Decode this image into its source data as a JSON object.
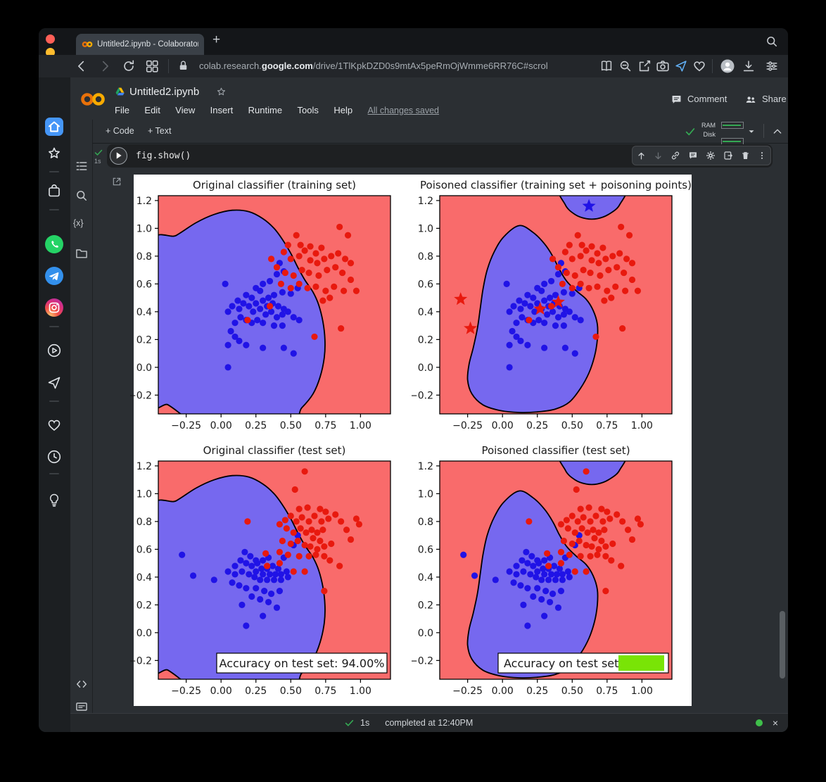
{
  "browser": {
    "tab_title": "Untitled2.ipynb - Colaboratory",
    "new_tab": "+",
    "url_prefix": "colab.research.",
    "url_host": "google.com",
    "url_path": "/drive/1TlKpkDZD0s9mtAx5peRmOjWmme6RR76C#scrol"
  },
  "colab": {
    "doc_title": "Untitled2.ipynb",
    "menus": [
      "File",
      "Edit",
      "View",
      "Insert",
      "Runtime",
      "Tools",
      "Help"
    ],
    "save_status": "All changes saved",
    "comment_label": "Comment",
    "share_label": "Share",
    "add_code": "+ Code",
    "add_text": "+ Text",
    "ram_label": "RAM",
    "disk_label": "Disk",
    "vars_label": "{x}",
    "cell": {
      "code": "fig.show()",
      "exec_badge": "1s"
    },
    "status_bar": {
      "duration": "1s",
      "message": "completed at 12:40PM",
      "close": "×"
    }
  },
  "chart_data": {
    "type": "scatter",
    "colors": {
      "region_red": "#f96b6b",
      "region_blue": "#7668ef",
      "point_red": "#e8190e",
      "point_blue": "#2013e6",
      "boundary": "#000000",
      "accuracy_green": "#79e406",
      "text": "#1a1a1a"
    },
    "axes": {
      "xlim": [
        -0.45,
        1.215
      ],
      "ylim": [
        -0.335,
        1.235
      ],
      "xticks": [
        -0.25,
        0,
        0.25,
        0.5,
        0.75,
        1.0
      ],
      "yticks": [
        -0.2,
        0,
        0.2,
        0.4,
        0.6,
        0.8,
        1.0,
        1.2
      ]
    },
    "regions": {
      "original": [
        [
          -0.52,
          0.84
        ],
        [
          -0.32,
          0.95
        ],
        [
          -0.18,
          1.04
        ],
        [
          -0.05,
          1.1
        ],
        [
          0.08,
          1.13
        ],
        [
          0.2,
          1.12
        ],
        [
          0.3,
          1.07
        ],
        [
          0.38,
          1.0
        ],
        [
          0.44,
          0.92
        ],
        [
          0.5,
          0.82
        ],
        [
          0.55,
          0.72
        ],
        [
          0.6,
          0.63
        ],
        [
          0.66,
          0.54
        ],
        [
          0.7,
          0.45
        ],
        [
          0.73,
          0.33
        ],
        [
          0.745,
          0.2
        ],
        [
          0.74,
          0.07
        ],
        [
          0.71,
          -0.07
        ],
        [
          0.66,
          -0.19
        ],
        [
          0.58,
          -0.29
        ],
        [
          0.46,
          -0.4
        ],
        [
          -0.2,
          -0.4
        ],
        [
          -0.27,
          -0.35
        ],
        [
          -0.38,
          -0.27
        ],
        [
          -0.52,
          -0.2
        ]
      ],
      "poisoned_main": [
        [
          0.12,
          1.02
        ],
        [
          0.22,
          0.97
        ],
        [
          0.3,
          0.89
        ],
        [
          0.36,
          0.8
        ],
        [
          0.41,
          0.7
        ],
        [
          0.46,
          0.62
        ],
        [
          0.53,
          0.55
        ],
        [
          0.6,
          0.49
        ],
        [
          0.65,
          0.41
        ],
        [
          0.68,
          0.31
        ],
        [
          0.68,
          0.2
        ],
        [
          0.66,
          0.08
        ],
        [
          0.62,
          -0.04
        ],
        [
          0.56,
          -0.15
        ],
        [
          0.48,
          -0.25
        ],
        [
          0.38,
          -0.3
        ],
        [
          0.26,
          -0.32
        ],
        [
          0.12,
          -0.325
        ],
        [
          -0.02,
          -0.31
        ],
        [
          -0.14,
          -0.27
        ],
        [
          -0.22,
          -0.19
        ],
        [
          -0.25,
          -0.09
        ],
        [
          -0.24,
          0.02
        ],
        [
          -0.21,
          0.14
        ],
        [
          -0.18,
          0.28
        ],
        [
          -0.16,
          0.42
        ],
        [
          -0.14,
          0.56
        ],
        [
          -0.11,
          0.7
        ],
        [
          -0.06,
          0.83
        ],
        [
          0.01,
          0.94
        ]
      ],
      "poisoned_top": [
        [
          0.43,
          1.3
        ],
        [
          0.45,
          1.17
        ],
        [
          0.52,
          1.1
        ],
        [
          0.6,
          1.07
        ],
        [
          0.68,
          1.07
        ],
        [
          0.76,
          1.1
        ],
        [
          0.84,
          1.17
        ],
        [
          0.86,
          1.3
        ]
      ]
    },
    "point_sets": {
      "train_blue": [
        [
          0.03,
          0.6
        ],
        [
          0.42,
          0.75
        ],
        [
          0.45,
          0.69
        ],
        [
          0.4,
          0.67
        ],
        [
          0.3,
          0.6
        ],
        [
          0.35,
          0.62
        ],
        [
          0.25,
          0.57
        ],
        [
          0.28,
          0.55
        ],
        [
          0.18,
          0.52
        ],
        [
          0.22,
          0.5
        ],
        [
          0.12,
          0.48
        ],
        [
          0.16,
          0.46
        ],
        [
          0.08,
          0.44
        ],
        [
          0.13,
          0.42
        ],
        [
          0.05,
          0.4
        ],
        [
          0.2,
          0.44
        ],
        [
          0.25,
          0.46
        ],
        [
          0.3,
          0.48
        ],
        [
          0.34,
          0.5
        ],
        [
          0.38,
          0.52
        ],
        [
          0.44,
          0.54
        ],
        [
          0.5,
          0.53
        ],
        [
          0.55,
          0.57
        ],
        [
          0.33,
          0.44
        ],
        [
          0.37,
          0.46
        ],
        [
          0.41,
          0.44
        ],
        [
          0.45,
          0.42
        ],
        [
          0.28,
          0.42
        ],
        [
          0.23,
          0.4
        ],
        [
          0.32,
          0.38
        ],
        [
          0.36,
          0.4
        ],
        [
          0.4,
          0.36
        ],
        [
          0.44,
          0.38
        ],
        [
          0.48,
          0.4
        ],
        [
          0.52,
          0.36
        ],
        [
          0.56,
          0.34
        ],
        [
          0.14,
          0.36
        ],
        [
          0.18,
          0.34
        ],
        [
          0.1,
          0.32
        ],
        [
          0.22,
          0.32
        ],
        [
          0.26,
          0.34
        ],
        [
          0.3,
          0.32
        ],
        [
          0.38,
          0.3
        ],
        [
          0.44,
          0.3
        ],
        [
          0.07,
          0.26
        ],
        [
          0.1,
          0.22
        ],
        [
          0.13,
          0.19
        ],
        [
          0.05,
          0.16
        ],
        [
          0.18,
          0.16
        ],
        [
          0.3,
          0.14
        ],
        [
          0.45,
          0.14
        ],
        [
          0.52,
          0.1
        ],
        [
          0.05,
          0.0
        ]
      ],
      "train_red": [
        [
          0.85,
          1.01
        ],
        [
          0.91,
          0.95
        ],
        [
          0.48,
          0.88
        ],
        [
          0.54,
          0.95
        ],
        [
          0.57,
          0.88
        ],
        [
          0.45,
          0.83
        ],
        [
          0.5,
          0.78
        ],
        [
          0.56,
          0.8
        ],
        [
          0.6,
          0.84
        ],
        [
          0.64,
          0.87
        ],
        [
          0.68,
          0.82
        ],
        [
          0.72,
          0.86
        ],
        [
          0.64,
          0.77
        ],
        [
          0.69,
          0.75
        ],
        [
          0.74,
          0.78
        ],
        [
          0.79,
          0.8
        ],
        [
          0.84,
          0.82
        ],
        [
          0.89,
          0.78
        ],
        [
          0.93,
          0.75
        ],
        [
          0.36,
          0.78
        ],
        [
          0.4,
          0.72
        ],
        [
          0.46,
          0.68
        ],
        [
          0.52,
          0.66
        ],
        [
          0.58,
          0.7
        ],
        [
          0.63,
          0.68
        ],
        [
          0.7,
          0.66
        ],
        [
          0.76,
          0.7
        ],
        [
          0.82,
          0.72
        ],
        [
          0.87,
          0.68
        ],
        [
          0.93,
          0.63
        ],
        [
          0.43,
          0.6
        ],
        [
          0.5,
          0.57
        ],
        [
          0.56,
          0.6
        ],
        [
          0.62,
          0.57
        ],
        [
          0.68,
          0.58
        ],
        [
          0.75,
          0.55
        ],
        [
          0.81,
          0.58
        ],
        [
          0.88,
          0.55
        ],
        [
          0.97,
          0.55
        ],
        [
          0.73,
          0.48
        ],
        [
          0.78,
          0.5
        ],
        [
          0.35,
          0.44
        ],
        [
          0.19,
          0.34
        ],
        [
          0.67,
          0.22
        ],
        [
          0.86,
          0.28
        ]
      ],
      "test_blue": [
        [
          -0.28,
          0.56
        ],
        [
          -0.2,
          0.41
        ],
        [
          0.55,
          0.7
        ],
        [
          0.52,
          0.63
        ],
        [
          0.17,
          0.58
        ],
        [
          0.21,
          0.55
        ],
        [
          0.25,
          0.52
        ],
        [
          0.14,
          0.52
        ],
        [
          0.18,
          0.5
        ],
        [
          0.22,
          0.48
        ],
        [
          0.1,
          0.48
        ],
        [
          0.26,
          0.5
        ],
        [
          0.3,
          0.52
        ],
        [
          0.34,
          0.54
        ],
        [
          0.45,
          0.54
        ],
        [
          0.05,
          0.44
        ],
        [
          0.1,
          0.42
        ],
        [
          0.15,
          0.44
        ],
        [
          0.2,
          0.42
        ],
        [
          0.25,
          0.44
        ],
        [
          0.29,
          0.46
        ],
        [
          0.33,
          0.46
        ],
        [
          0.37,
          0.48
        ],
        [
          0.41,
          0.46
        ],
        [
          0.3,
          0.42
        ],
        [
          0.35,
          0.42
        ],
        [
          0.39,
          0.42
        ],
        [
          0.43,
          0.42
        ],
        [
          0.47,
          0.44
        ],
        [
          0.24,
          0.4
        ],
        [
          0.28,
          0.38
        ],
        [
          0.33,
          0.38
        ],
        [
          0.38,
          0.38
        ],
        [
          0.43,
          0.38
        ],
        [
          0.48,
          0.4
        ],
        [
          -0.05,
          0.38
        ],
        [
          0.08,
          0.36
        ],
        [
          0.13,
          0.34
        ],
        [
          0.18,
          0.32
        ],
        [
          0.25,
          0.32
        ],
        [
          0.31,
          0.3
        ],
        [
          0.36,
          0.28
        ],
        [
          0.42,
          0.3
        ],
        [
          0.22,
          0.26
        ],
        [
          0.28,
          0.24
        ],
        [
          0.34,
          0.22
        ],
        [
          0.15,
          0.2
        ],
        [
          0.4,
          0.18
        ],
        [
          0.3,
          0.12
        ],
        [
          0.18,
          0.05
        ]
      ],
      "test_red": [
        [
          0.6,
          1.16
        ],
        [
          0.53,
          1.03
        ],
        [
          0.56,
          0.89
        ],
        [
          0.62,
          0.9
        ],
        [
          0.71,
          0.89
        ],
        [
          0.75,
          0.87
        ],
        [
          0.46,
          0.81
        ],
        [
          0.5,
          0.84
        ],
        [
          0.54,
          0.8
        ],
        [
          0.58,
          0.83
        ],
        [
          0.63,
          0.8
        ],
        [
          0.67,
          0.84
        ],
        [
          0.72,
          0.8
        ],
        [
          0.77,
          0.82
        ],
        [
          0.82,
          0.85
        ],
        [
          0.86,
          0.8
        ],
        [
          0.97,
          0.82
        ],
        [
          0.99,
          0.78
        ],
        [
          0.19,
          0.8
        ],
        [
          0.42,
          0.78
        ],
        [
          0.47,
          0.75
        ],
        [
          0.52,
          0.72
        ],
        [
          0.57,
          0.75
        ],
        [
          0.61,
          0.72
        ],
        [
          0.65,
          0.74
        ],
        [
          0.69,
          0.72
        ],
        [
          0.73,
          0.74
        ],
        [
          0.66,
          0.68
        ],
        [
          0.71,
          0.66
        ],
        [
          0.44,
          0.66
        ],
        [
          0.5,
          0.64
        ],
        [
          0.55,
          0.66
        ],
        [
          0.6,
          0.63
        ],
        [
          0.64,
          0.62
        ],
        [
          0.69,
          0.6
        ],
        [
          0.74,
          0.62
        ],
        [
          0.79,
          0.64
        ],
        [
          0.9,
          0.74
        ],
        [
          0.93,
          0.67
        ],
        [
          0.32,
          0.57
        ],
        [
          0.42,
          0.58
        ],
        [
          0.48,
          0.56
        ],
        [
          0.56,
          0.55
        ],
        [
          0.63,
          0.55
        ],
        [
          0.68,
          0.56
        ],
        [
          0.74,
          0.55
        ],
        [
          0.78,
          0.52
        ],
        [
          0.85,
          0.48
        ],
        [
          0.33,
          0.48
        ],
        [
          0.42,
          0.5
        ],
        [
          0.52,
          0.44
        ],
        [
          0.6,
          0.44
        ],
        [
          0.74,
          0.3
        ]
      ]
    },
    "plots": [
      {
        "id": "tl",
        "title": "Original classifier (training set)",
        "blue_regions": [
          "original"
        ],
        "blue_points": "train_blue",
        "red_points": "train_red",
        "red_stars": [],
        "blue_stars": [],
        "label": null
      },
      {
        "id": "tr",
        "title": "Poisoned classifier (training set + poisoning points)",
        "blue_regions": [
          "poisoned_main",
          "poisoned_top"
        ],
        "blue_points": "train_blue",
        "red_points": "train_red",
        "red_stars": [
          [
            -0.3,
            0.49
          ],
          [
            -0.23,
            0.28
          ],
          [
            0.27,
            0.42
          ],
          [
            0.4,
            0.47
          ]
        ],
        "blue_stars": [
          [
            0.62,
            1.16
          ]
        ],
        "label": null
      },
      {
        "id": "bl",
        "title": "Original classifier (test set)",
        "blue_regions": [
          "original"
        ],
        "blue_points": "test_blue",
        "red_points": "test_red",
        "red_stars": [],
        "blue_stars": [],
        "label": {
          "text": "Accuracy on test set: 94.00%",
          "redacted": false
        }
      },
      {
        "id": "br",
        "title": "Poisoned classifier (test set)",
        "blue_regions": [
          "poisoned_main",
          "poisoned_top"
        ],
        "blue_points": "test_blue",
        "red_points": "test_red",
        "red_stars": [],
        "blue_stars": [],
        "label": {
          "text": "Accuracy on test set:",
          "redacted": true
        }
      }
    ]
  }
}
